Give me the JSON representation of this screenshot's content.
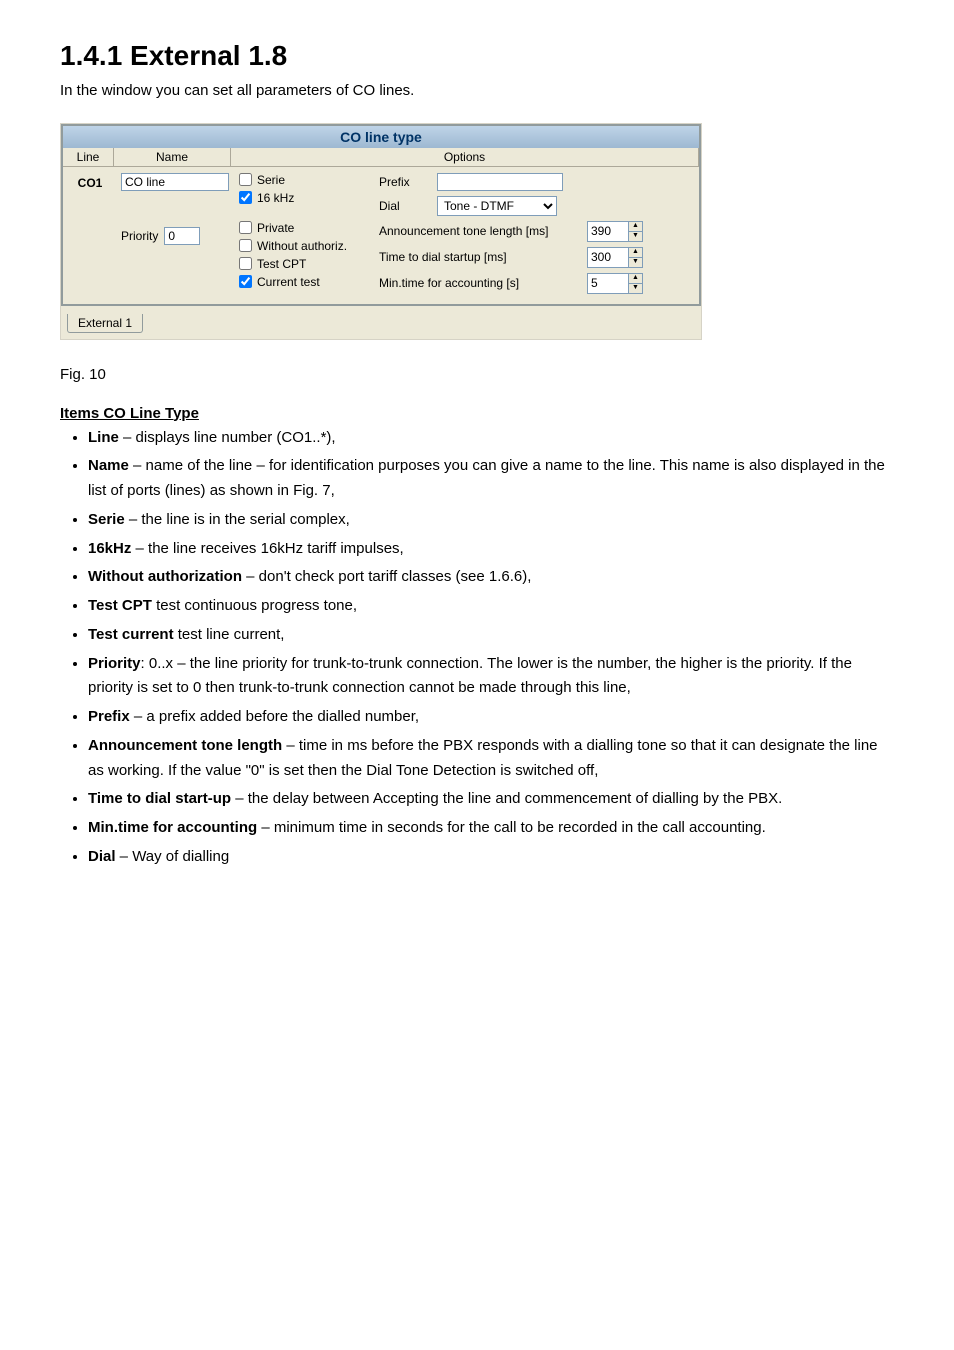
{
  "title": "1.4.1  External 1.8",
  "intro": "In the window you can set all parameters of CO lines.",
  "panel": {
    "title": "CO line type",
    "headers": {
      "line": "Line",
      "name": "Name",
      "options": "Options"
    },
    "line_id": "CO1",
    "name_value": "CO line",
    "priority_label": "Priority",
    "priority_value": "0",
    "checks": {
      "serie": {
        "label": "Serie",
        "checked": false
      },
      "khz": {
        "label": "16 kHz",
        "checked": true
      },
      "private": {
        "label": "Private",
        "checked": false
      },
      "without": {
        "label": "Without authoriz.",
        "checked": false
      },
      "testcpt": {
        "label": "Test CPT",
        "checked": false
      },
      "current": {
        "label": "Current test",
        "checked": true
      }
    },
    "right": {
      "prefix_label": "Prefix",
      "prefix_value": "",
      "dial_label": "Dial",
      "dial_value": "Tone - DTMF",
      "ann_label": "Announcement tone length [ms]",
      "ann_value": "390",
      "startup_label": "Time to dial startup [ms]",
      "startup_value": "300",
      "min_label": "Min.time for accounting [s]",
      "min_value": "5"
    },
    "tab": "External 1"
  },
  "sections": {
    "items_title": "Items  CO Line Type",
    "items": [
      {
        "k": "Line",
        "t": " – displays line number (CO1..*),"
      },
      {
        "k": "Name",
        "t": " – name of the line – for identification purposes you can give a name to the line. This name is also displayed in the list of ports (lines) as shown in Fig. 7,"
      },
      {
        "k": "Serie",
        "t": " – the line is in the serial complex,"
      },
      {
        "k": "16kHz",
        "t": " – the line receives 16kHz tariff impulses,"
      },
      {
        "k": "Without authorization",
        "t": " – don't check port tariff classes (see 1.6.6),"
      },
      {
        "k": "Test CPT",
        "t": " test continuous progress tone,"
      },
      {
        "k": "Test current",
        "t": " test line current,"
      },
      {
        "k": "Priority",
        "t": ": 0..x – the line priority for trunk-to-trunk connection. The lower is the number, the higher is the priority. If the priority is set to 0 then trunk-to-trunk connection cannot be made through this line,"
      },
      {
        "k": "Prefix",
        "t": " – a prefix added before the dialled number,"
      },
      {
        "k": "Announcement tone length",
        "t": " – time in ms before the PBX responds with a dialling tone so that it can designate the line as working. If the value \"0\" is set then the Dial Tone Detection is switched off,"
      },
      {
        "k": "Time to dial start-up",
        "t": " – the delay between Accepting the line and commencement of dialling by the PBX."
      },
      {
        "k": "Min.time for accounting",
        "t": " – minimum time in seconds for the call to be recorded in the call accounting."
      },
      {
        "k": "Dial",
        "t": " – Way of dialling"
      }
    ]
  }
}
